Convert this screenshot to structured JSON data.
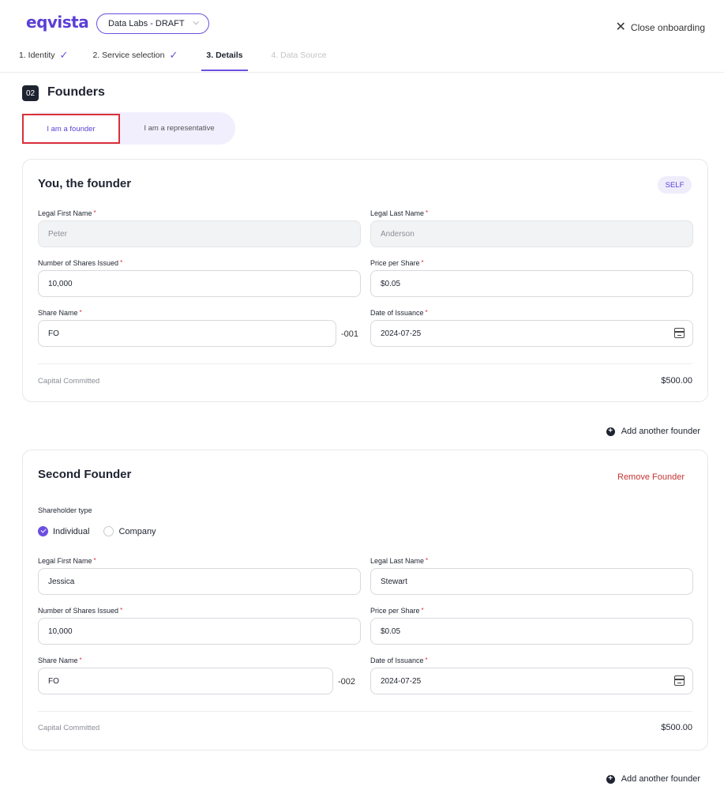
{
  "header": {
    "logo": "eqvista",
    "company_select": "Data Labs - DRAFT",
    "close_label": "Close onboarding"
  },
  "steps": [
    {
      "label": "1. Identity",
      "state": "done"
    },
    {
      "label": "2. Service selection",
      "state": "done"
    },
    {
      "label": "3. Details",
      "state": "active"
    },
    {
      "label": "4. Data Source",
      "state": "disabled"
    }
  ],
  "section": {
    "number": "02",
    "title": "Founders"
  },
  "role_toggle": {
    "founder": "I am a founder",
    "representative": "I am a representative"
  },
  "labels": {
    "first_name": "Legal First Name",
    "last_name": "Legal Last Name",
    "shares": "Number of Shares Issued",
    "price": "Price per Share",
    "share_name": "Share Name",
    "date": "Date of Issuance",
    "capital": "Capital Committed",
    "required_mark": "*"
  },
  "founder1": {
    "title": "You, the founder",
    "badge": "SELF",
    "first_name": "Peter",
    "last_name": "Anderson",
    "shares": "10,000",
    "price": "$0.05",
    "share_name": "FO",
    "share_suffix": "-001",
    "date": "2024-07-25",
    "capital": "$500.00"
  },
  "add_founder_label": "Add another founder",
  "founder2": {
    "title": "Second Founder",
    "remove_label": "Remove Founder",
    "shareholder_type_label": "Shareholder type",
    "type_individual": "Individual",
    "type_company": "Company",
    "first_name": "Jessica",
    "last_name": "Stewart",
    "shares": "10,000",
    "price": "$0.05",
    "share_name": "FO",
    "share_suffix": "-002",
    "date": "2024-07-25",
    "capital": "$500.00"
  },
  "colors": {
    "accent": "#6b4fe0",
    "danger": "#c83232",
    "highlight_border": "#d92f3a"
  }
}
